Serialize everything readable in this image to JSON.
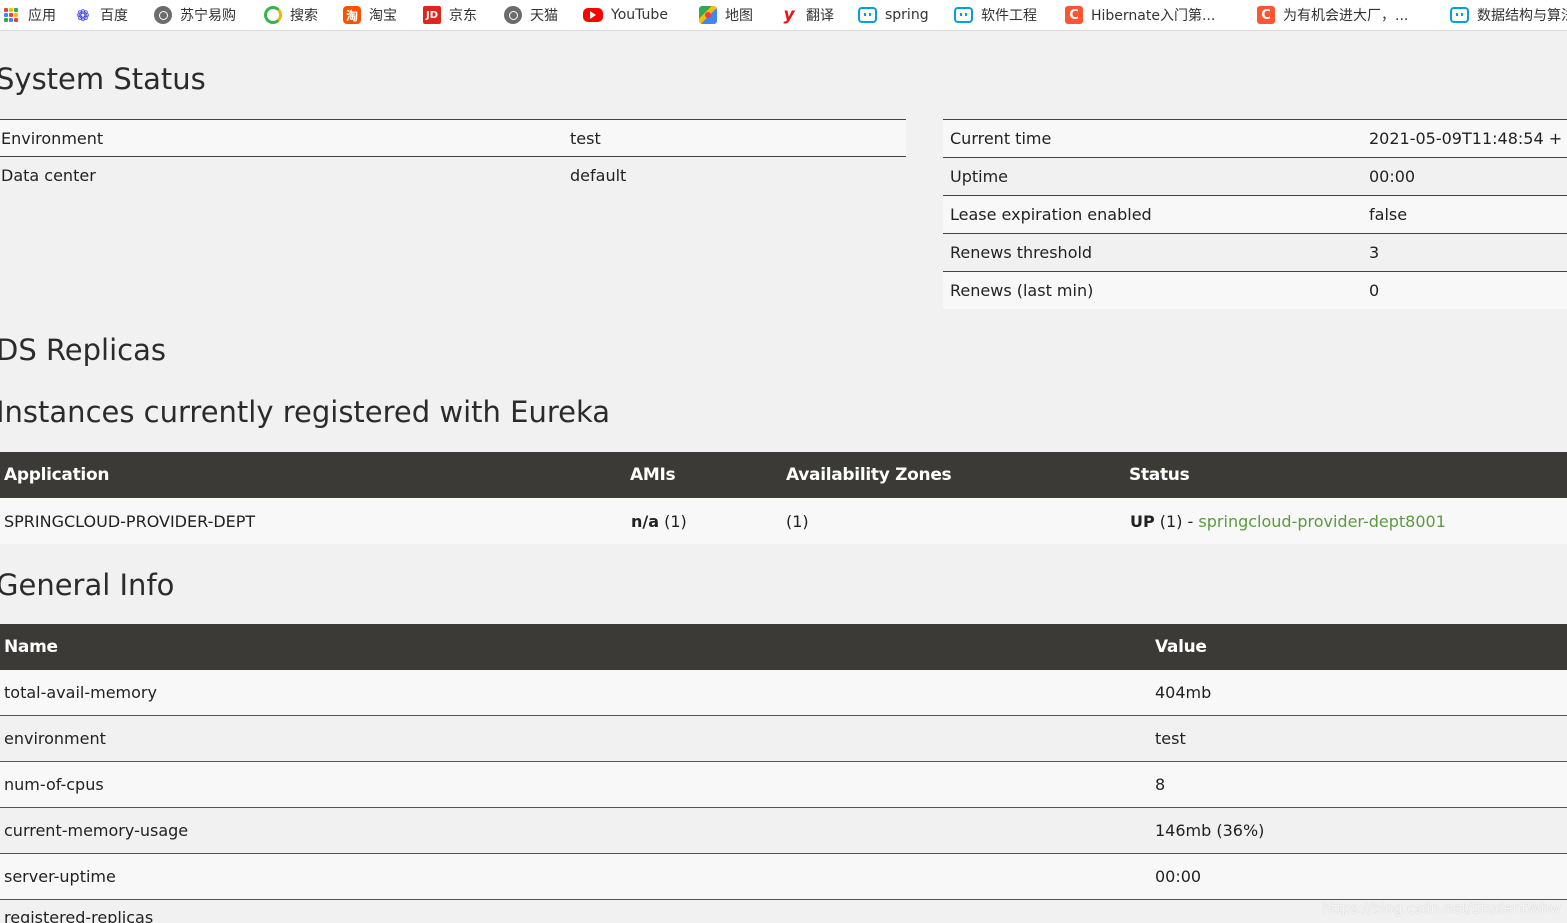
{
  "bookmarks": [
    {
      "label": "应用",
      "icon": "apps-grid-icon"
    },
    {
      "label": "百度",
      "icon": "baidu-paw-icon"
    },
    {
      "label": "苏宁易购",
      "icon": "globe-icon"
    },
    {
      "label": "搜索",
      "icon": "360-search-icon"
    },
    {
      "label": "淘宝",
      "icon": "taobao-icon"
    },
    {
      "label": "京东",
      "icon": "jd-icon"
    },
    {
      "label": "天猫",
      "icon": "globe-icon"
    },
    {
      "label": "YouTube",
      "icon": "youtube-icon"
    },
    {
      "label": "地图",
      "icon": "maps-icon"
    },
    {
      "label": "翻译",
      "icon": "youdao-icon"
    },
    {
      "label": "spring",
      "icon": "bilibili-icon"
    },
    {
      "label": "软件工程",
      "icon": "bilibili-icon"
    },
    {
      "label": "Hibernate入门第...",
      "icon": "csdn-icon"
    },
    {
      "label": "为有机会进大厂，...",
      "icon": "csdn-icon"
    },
    {
      "label": "数据结构与算法",
      "icon": "bilibili-icon"
    }
  ],
  "system_status": {
    "title": "System Status",
    "left": [
      {
        "key": "Environment",
        "value": "test"
      },
      {
        "key": "Data center",
        "value": "default"
      }
    ],
    "right": [
      {
        "key": "Current time",
        "value": "2021-05-09T11:48:54 +"
      },
      {
        "key": "Uptime",
        "value": "00:00"
      },
      {
        "key": "Lease expiration enabled",
        "value": "false"
      },
      {
        "key": "Renews threshold",
        "value": "3"
      },
      {
        "key": "Renews (last min)",
        "value": "0"
      }
    ]
  },
  "ds_replicas": {
    "title": "DS Replicas"
  },
  "instances": {
    "title": "Instances currently registered with Eureka",
    "headers": [
      "Application",
      "AMIs",
      "Availability Zones",
      "Status"
    ],
    "rows": [
      {
        "application": "SPRINGCLOUD-PROVIDER-DEPT",
        "amis_bold": "n/a",
        "amis_count": " (1)",
        "zones": "(1)",
        "status_bold": "UP",
        "status_rest": " (1) - ",
        "status_link": "springcloud-provider-dept8001"
      }
    ]
  },
  "general_info": {
    "title": "General Info",
    "headers": [
      "Name",
      "Value"
    ],
    "rows": [
      {
        "name": "total-avail-memory",
        "value": "404mb"
      },
      {
        "name": "environment",
        "value": "test"
      },
      {
        "name": "num-of-cpus",
        "value": "8"
      },
      {
        "name": "current-memory-usage",
        "value": "146mb (36%)"
      },
      {
        "name": "server-uptime",
        "value": "00:00"
      },
      {
        "name": "registered-replicas",
        "value": ""
      }
    ]
  },
  "watermark": "https://blog.csdn.net/StudentWhw",
  "colors": {
    "header_bg": "#3c3a37",
    "page_bg": "#f1f1f1",
    "link": "#5b9b3b"
  }
}
